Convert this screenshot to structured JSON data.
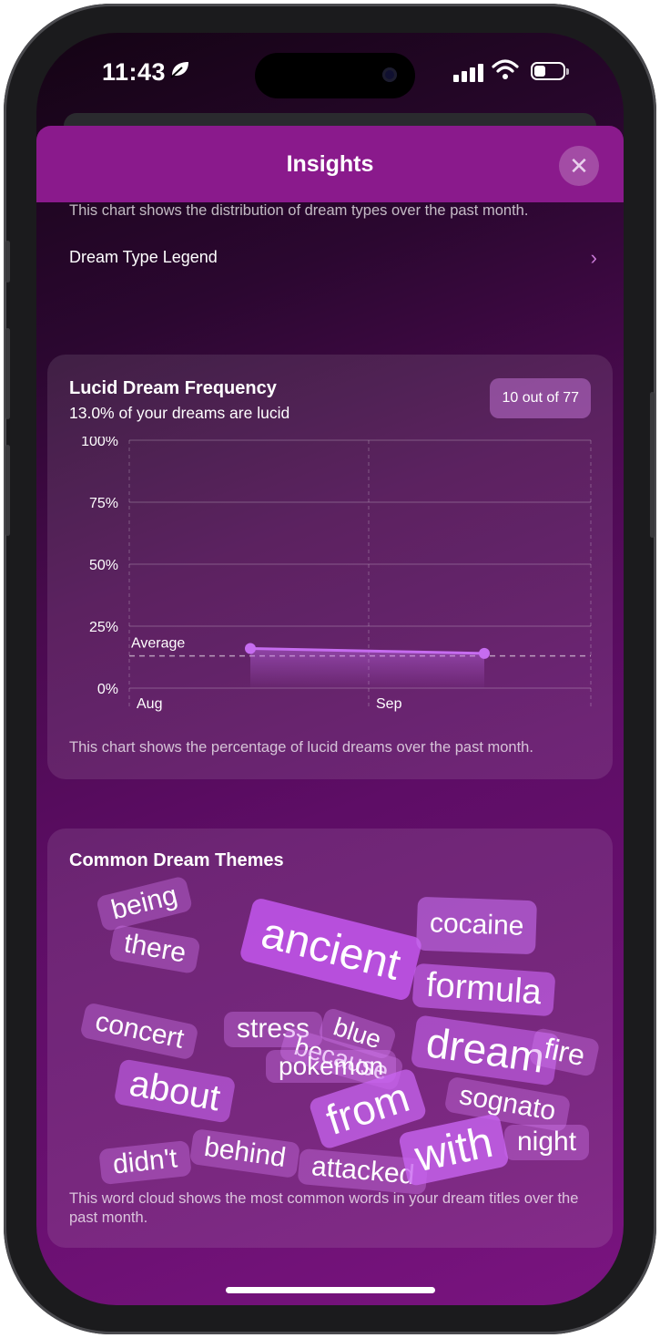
{
  "status": {
    "time": "11:43"
  },
  "header": {
    "title": "Insights",
    "close_label": "✕"
  },
  "dream_type": {
    "caption": "This chart shows the distribution of dream types over the past month.",
    "legend_label": "Dream Type Legend"
  },
  "lucid": {
    "title": "Lucid Dream Frequency",
    "subtitle": "13.0% of your dreams are lucid",
    "badge": "10 out of 77",
    "caption": "This chart shows the percentage of lucid dreams over the past month."
  },
  "chart_data": {
    "type": "line",
    "x": [
      "Aug",
      "Sep"
    ],
    "y_ticks": [
      "0%",
      "25%",
      "50%",
      "75%",
      "100%"
    ],
    "ylim": [
      0,
      100
    ],
    "series": [
      {
        "values": [
          16,
          14
        ]
      }
    ],
    "average": {
      "label": "Average",
      "value": 13
    }
  },
  "themes": {
    "title": "Common Dream Themes",
    "caption": "This word cloud shows the most common words in your dream titles over the past month.",
    "words": [
      "being",
      "there",
      "ancient",
      "cocaine",
      "formula",
      "concert",
      "stress",
      "blue",
      "because",
      "pokemon",
      "dream",
      "fire",
      "about",
      "from",
      "sognato",
      "night",
      "didn't",
      "behind",
      "attacked",
      "with"
    ]
  },
  "colors": {
    "accent": "#c060e0",
    "header": "#8a1a8c",
    "line": "#c66cf0"
  }
}
